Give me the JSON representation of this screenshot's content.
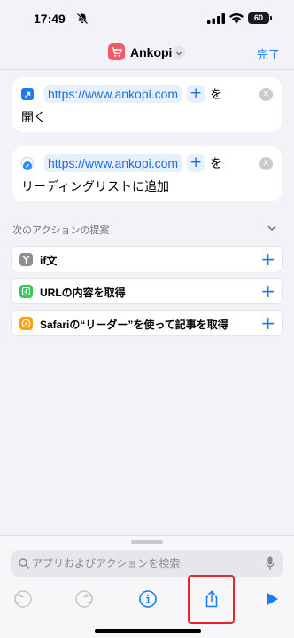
{
  "status_bar": {
    "time": "17:49",
    "battery": "60"
  },
  "nav": {
    "app_name": "Ankopi",
    "done_label": "完了"
  },
  "actions": [
    {
      "url_token": "https://www.ankopi.com",
      "suffix": "を",
      "line2": "開く"
    },
    {
      "url_token": "https://www.ankopi.com",
      "suffix": "を",
      "line2": "リーディングリストに追加"
    }
  ],
  "suggestions": {
    "header": "次のアクションの提案",
    "items": [
      {
        "label": "if文",
        "color": "#8e8e93"
      },
      {
        "label": "URLの内容を取得",
        "color": "#34c759"
      },
      {
        "label": "Safariの“リーダー”を使って記事を取得",
        "color": "#ff9f0a"
      }
    ]
  },
  "search": {
    "placeholder": "アプリおよびアクションを検索"
  },
  "colors": {
    "accent": "#1a7cf5",
    "highlight": "#e8242c"
  }
}
